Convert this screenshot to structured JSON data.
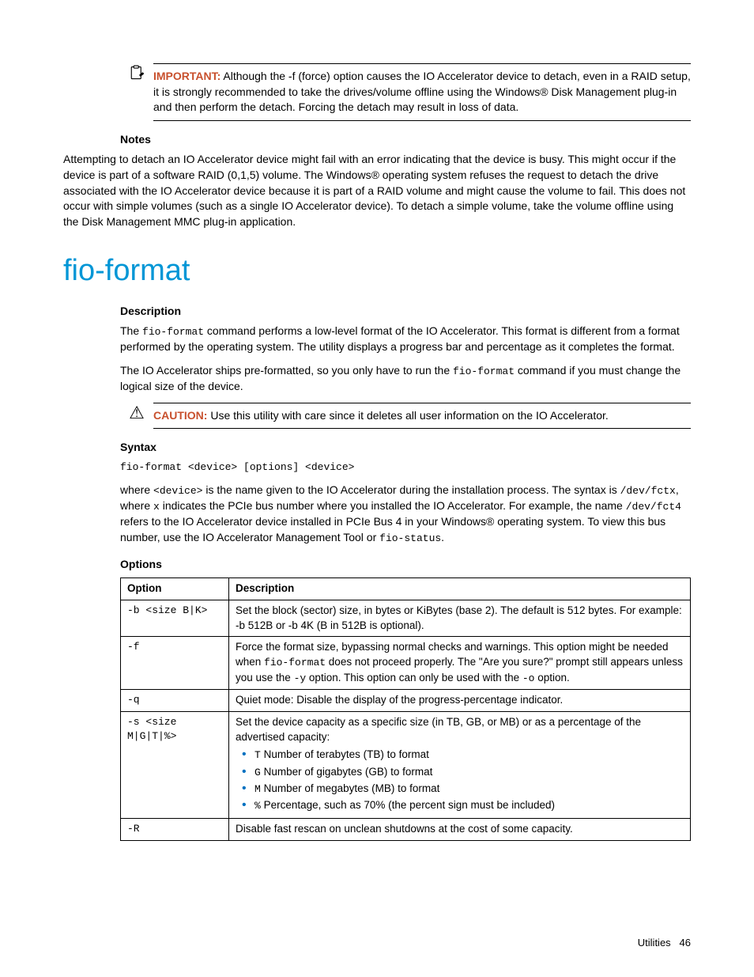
{
  "important_box": {
    "label": "IMPORTANT:",
    "text": "Although the -f (force) option causes the IO Accelerator device to detach, even in a RAID setup, it is strongly recommended to take the drives/volume offline using the Windows® Disk Management plug-in and then perform the detach. Forcing the detach may result in loss of data."
  },
  "notes": {
    "heading": "Notes",
    "para": "Attempting to detach an IO Accelerator device might fail with an error indicating that the device is busy. This might occur if the device is part of a software RAID (0,1,5) volume. The Windows® operating system refuses the request to detach the drive associated with the IO Accelerator device because it is part of a RAID volume and might cause the volume to fail. This does not occur with simple volumes (such as a single IO Accelerator device). To detach a simple volume, take the volume offline using the Disk Management MMC plug-in application."
  },
  "title": "fio-format",
  "description": {
    "heading": "Description",
    "p1a": "The ",
    "p1code": "fio-format",
    "p1b": " command performs a low-level format of the IO Accelerator. This format is different from a format performed by the operating system. The utility displays a progress bar and percentage as it completes the format.",
    "p2a": "The IO Accelerator ships pre-formatted, so you only have to run the ",
    "p2code": "fio-format",
    "p2b": " command if you must change the logical size of the device."
  },
  "caution_box": {
    "label": "CAUTION:",
    "text": "Use this utility with care since it deletes all user information on the IO Accelerator."
  },
  "syntax": {
    "heading": "Syntax",
    "code": "fio-format <device> [options] <device>",
    "p_a": "where ",
    "p_dev": "<device>",
    "p_b": " is the name given to the IO Accelerator during the installation process. The syntax is ",
    "p_path": "/dev/fctx",
    "p_c": ", where ",
    "p_x": "x",
    "p_d": " indicates the PCIe bus number where you installed the IO Accelerator. For example, the name ",
    "p_path2": "/dev/fct4",
    "p_e": " refers to the IO Accelerator device installed in PCIe Bus 4 in your Windows® operating system. To view this bus number, use the IO Accelerator Management Tool or ",
    "p_fs": "fio-status",
    "p_f": "."
  },
  "options": {
    "heading": "Options",
    "th_option": "Option",
    "th_desc": "Description",
    "rows": [
      {
        "opt": "-b <size B|K>",
        "desc_plain": "Set the block (sector) size, in bytes or KiBytes (base 2). The default is 512 bytes. For example: -b 512B or -b 4K (B in 512B is optional)."
      },
      {
        "opt": "-f",
        "desc_a": "Force the format size, bypassing normal checks and warnings. This option might be needed when ",
        "desc_code1": "fio-format",
        "desc_b": " does not proceed properly. The \"Are you sure?\" prompt still appears unless you use the ",
        "desc_code2": "-y",
        "desc_c": " option. This option can only be used with the ",
        "desc_code3": "-o",
        "desc_d": " option."
      },
      {
        "opt": "-q",
        "desc_plain": "Quiet mode: Disable the display of the progress-percentage indicator."
      },
      {
        "opt": "-s <size M|G|T|%>",
        "desc_intro": "Set the device capacity as a specific size (in TB, GB, or MB) or as a percentage of the advertised capacity:",
        "li1_code": "T",
        "li1_text": " Number of terabytes (TB) to format",
        "li2_code": "G",
        "li2_text": " Number of gigabytes (GB) to format",
        "li3_code": "M",
        "li3_text": " Number of megabytes (MB) to format",
        "li4_code": "%",
        "li4_text": " Percentage, such as 70% (the percent sign must be included)"
      },
      {
        "opt": "-R",
        "desc_plain": "Disable fast rescan on unclean shutdowns at the cost of some capacity."
      }
    ]
  },
  "footer": {
    "section": "Utilities",
    "page": "46"
  }
}
